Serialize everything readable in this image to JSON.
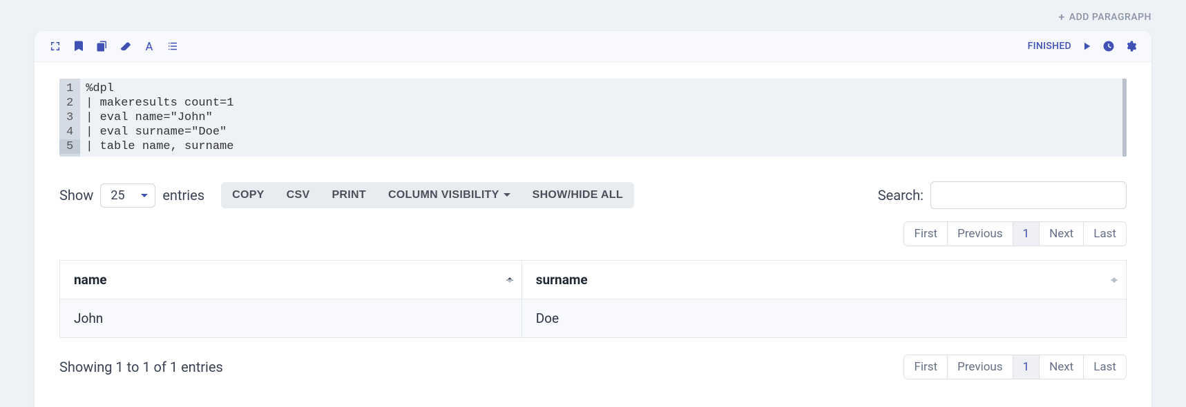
{
  "topbar": {
    "add_paragraph": "ADD PARAGRAPH"
  },
  "header": {
    "status": "FINISHED"
  },
  "code": {
    "lines": [
      "%dpl",
      "| makeresults count=1",
      "| eval name=\"John\"",
      "| eval surname=\"Doe\"",
      "| table name, surname"
    ]
  },
  "controls": {
    "show_label": "Show",
    "entries_label": "entries",
    "page_size": "25",
    "buttons": {
      "copy": "COPY",
      "csv": "CSV",
      "print": "PRINT",
      "colvis": "COLUMN VISIBILITY",
      "showhide": "SHOW/HIDE ALL"
    },
    "search_label": "Search:",
    "search_value": ""
  },
  "pagination": {
    "first": "First",
    "previous": "Previous",
    "page1": "1",
    "next": "Next",
    "last": "Last"
  },
  "table": {
    "columns": [
      "name",
      "surname"
    ],
    "rows": [
      {
        "name": "John",
        "surname": "Doe"
      }
    ]
  },
  "footer": {
    "info": "Showing 1 to 1 of 1 entries"
  }
}
